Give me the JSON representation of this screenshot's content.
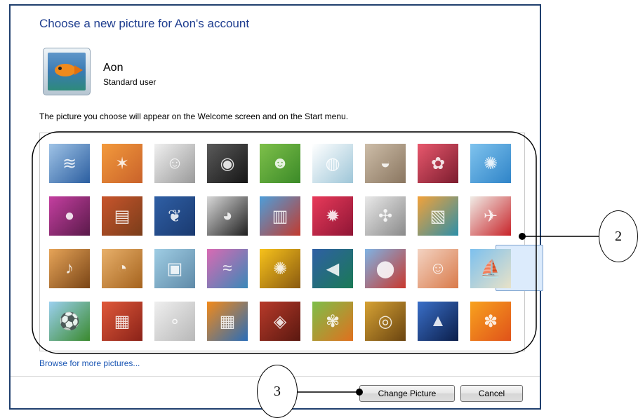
{
  "dialog": {
    "title": "Choose a new picture for Aon's account",
    "user": {
      "name": "Aon",
      "type": "Standard user"
    },
    "description": "The picture you choose will appear on the Welcome screen and on the Start menu.",
    "browse_link": "Browse for more pictures...",
    "buttons": {
      "change": "Change Picture",
      "cancel": "Cancel"
    },
    "selected_picture": "sailboat"
  },
  "pictures": [
    {
      "name": "roller-coaster",
      "c1": "#9fc3e6",
      "c2": "#2b5ea0",
      "glyph": "≋"
    },
    {
      "name": "starfish",
      "c1": "#f39a3c",
      "c2": "#c9622a",
      "glyph": "✶"
    },
    {
      "name": "robot-toy",
      "c1": "#f0f0f0",
      "c2": "#9a9a9a",
      "glyph": "☺"
    },
    {
      "name": "record-player",
      "c1": "#5a5a5a",
      "c2": "#161616",
      "glyph": "◉"
    },
    {
      "name": "lucky-cat",
      "c1": "#7ec04a",
      "c2": "#3b8a28",
      "glyph": "☻"
    },
    {
      "name": "spinning-top",
      "c1": "#ffffff",
      "c2": "#9ec6d8",
      "glyph": "◍"
    },
    {
      "name": "kitten",
      "c1": "#cdbda8",
      "c2": "#8a7660",
      "glyph": "◒"
    },
    {
      "name": "pink-flower",
      "c1": "#e8586d",
      "c2": "#7b1c2e",
      "glyph": "✿"
    },
    {
      "name": "ferris-wheel",
      "c1": "#7fc3ee",
      "c2": "#2f84c8",
      "glyph": "✺"
    },
    {
      "name": "green-ball",
      "c1": "#c43fa0",
      "c2": "#5a1a4a",
      "glyph": "●"
    },
    {
      "name": "fabric-rolls",
      "c1": "#c8552c",
      "c2": "#7a3d1a",
      "glyph": "▤"
    },
    {
      "name": "yellow-leaf",
      "c1": "#2f5fa5",
      "c2": "#1a3a70",
      "glyph": "❦"
    },
    {
      "name": "dog",
      "c1": "#d8d8d8",
      "c2": "#202020",
      "glyph": "◕"
    },
    {
      "name": "crayons",
      "c1": "#4e9ed9",
      "c2": "#c23a2e",
      "glyph": "▥"
    },
    {
      "name": "red-star",
      "c1": "#e83a5a",
      "c2": "#8f1535",
      "glyph": "✹"
    },
    {
      "name": "jacks",
      "c1": "#e9e9e9",
      "c2": "#8a8a8a",
      "glyph": "✣"
    },
    {
      "name": "stairs",
      "c1": "#f2a23a",
      "c2": "#2d8fa8",
      "glyph": "▧"
    },
    {
      "name": "paper-crane",
      "c1": "#f0ece6",
      "c2": "#c8242a",
      "glyph": "✈"
    },
    {
      "name": "guitar",
      "c1": "#e6a458",
      "c2": "#7a4516",
      "glyph": "♪"
    },
    {
      "name": "pomeranian",
      "c1": "#e8b06a",
      "c2": "#a5631e",
      "glyph": "◔"
    },
    {
      "name": "tin-robot",
      "c1": "#9fcde4",
      "c2": "#5f8aa8",
      "glyph": "▣"
    },
    {
      "name": "scarf",
      "c1": "#d96ab3",
      "c2": "#3a88b8",
      "glyph": "≈"
    },
    {
      "name": "sunflower",
      "c1": "#f7c21b",
      "c2": "#8a5a10",
      "glyph": "✺"
    },
    {
      "name": "fish",
      "c1": "#2f5fa5",
      "c2": "#1a7a55",
      "glyph": "◀"
    },
    {
      "name": "hot-air-balloon",
      "c1": "#7fb3e4",
      "c2": "#c8382e",
      "glyph": "⬤"
    },
    {
      "name": "doll",
      "c1": "#f3d3c2",
      "c2": "#d97a4a",
      "glyph": "☺"
    },
    {
      "name": "sailboat",
      "c1": "#7cc0ee",
      "c2": "#e8e2c8",
      "glyph": "⛵"
    },
    {
      "name": "soccer-ball",
      "c1": "#9bd0ef",
      "c2": "#3a8a2e",
      "glyph": "⚽"
    },
    {
      "name": "red-fabric",
      "c1": "#e0593a",
      "c2": "#8a2218",
      "glyph": "▦"
    },
    {
      "name": "marbles",
      "c1": "#efefef",
      "c2": "#b8b8b8",
      "glyph": "∘"
    },
    {
      "name": "window",
      "c1": "#f28a1a",
      "c2": "#2a6db8",
      "glyph": "▦"
    },
    {
      "name": "rug",
      "c1": "#b83a2a",
      "c2": "#5a1810",
      "glyph": "◈"
    },
    {
      "name": "butterfly",
      "c1": "#7dbf4a",
      "c2": "#e0701e",
      "glyph": "✾"
    },
    {
      "name": "spiral",
      "c1": "#d6a234",
      "c2": "#6a4410",
      "glyph": "◎"
    },
    {
      "name": "lighthouse",
      "c1": "#3a6fc8",
      "c2": "#0b1e4a",
      "glyph": "▲"
    },
    {
      "name": "orange-daisy",
      "c1": "#f8a21e",
      "c2": "#e0521a",
      "glyph": "✽"
    }
  ],
  "annotations": [
    {
      "label": "2"
    },
    {
      "label": "3"
    }
  ]
}
